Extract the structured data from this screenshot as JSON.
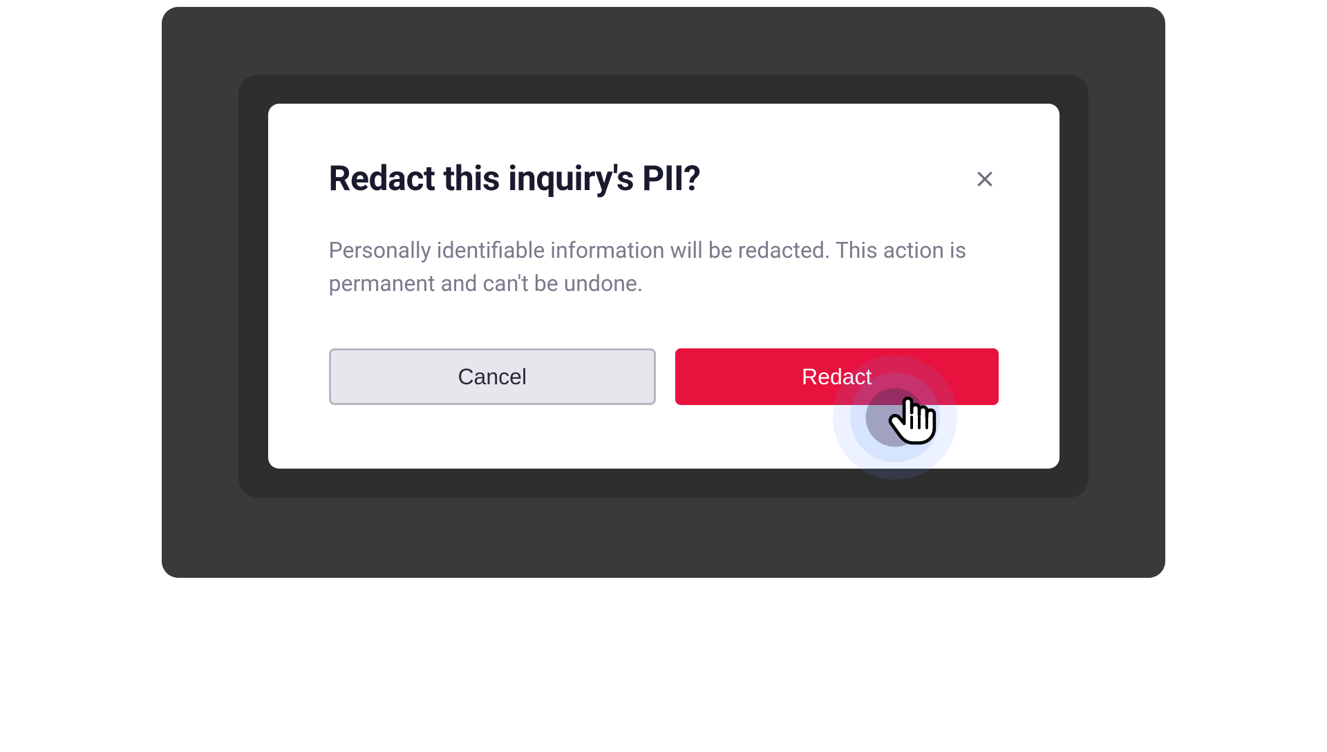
{
  "modal": {
    "title": "Redact this inquiry's PII?",
    "description": "Personally identifiable information will be redacted. This action is permanent and can't be undone.",
    "cancel_label": "Cancel",
    "redact_label": "Redact"
  },
  "colors": {
    "primary_action": "#e8123e",
    "secondary_action_bg": "#e8e6ed",
    "secondary_action_border": "#b8b5c4",
    "text_dark": "#1a1a2e",
    "text_muted": "#7a7a8c",
    "backdrop_outer": "#3a3a3a",
    "backdrop_inner": "#2e2e2e"
  }
}
